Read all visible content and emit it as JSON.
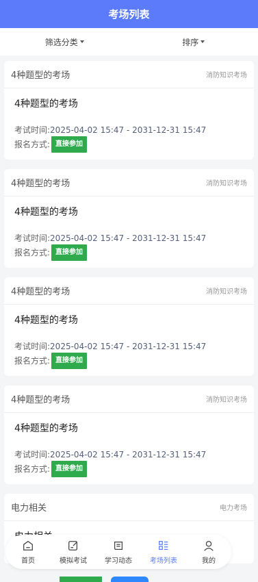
{
  "header": {
    "title": "考场列表"
  },
  "filters": {
    "filter_label": "筛选分类",
    "sort_label": "排序"
  },
  "cards": [
    {
      "title": "4种题型的考场",
      "category": "消防知识考场",
      "name": "4种题型的考场",
      "time_label": "考试时间:",
      "time_value": "2025-04-02 15:47 - 2031-12-31 15:47",
      "signup_label": "报名方式:",
      "signup_value": "直接参加"
    },
    {
      "title": "4种题型的考场",
      "category": "消防知识考场",
      "name": "4种题型的考场",
      "time_label": "考试时间:",
      "time_value": "2025-04-02 15:47 - 2031-12-31 15:47",
      "signup_label": "报名方式:",
      "signup_value": "直接参加"
    },
    {
      "title": "4种题型的考场",
      "category": "消防知识考场",
      "name": "4种题型的考场",
      "time_label": "考试时间:",
      "time_value": "2025-04-02 15:47 - 2031-12-31 15:47",
      "signup_label": "报名方式:",
      "signup_value": "直接参加"
    },
    {
      "title": "4种题型的考场",
      "category": "消防知识考场",
      "name": "4种题型的考场",
      "time_label": "考试时间:",
      "time_value": "2025-04-02 15:47 - 2031-12-31 15:47",
      "signup_label": "报名方式:",
      "signup_value": "直接参加"
    },
    {
      "title": "电力相关",
      "category": "电力考场",
      "name": "电力相关"
    }
  ],
  "tabbar": {
    "items": [
      {
        "label": "首页",
        "icon": "home-icon"
      },
      {
        "label": "模拟考试",
        "icon": "edit-icon"
      },
      {
        "label": "学习动态",
        "icon": "news-icon"
      },
      {
        "label": "考场列表",
        "icon": "list-icon",
        "active": true
      },
      {
        "label": "我的",
        "icon": "user-icon"
      }
    ]
  },
  "colors": {
    "primary": "#5b7bfb",
    "join": "#2fab4d"
  }
}
